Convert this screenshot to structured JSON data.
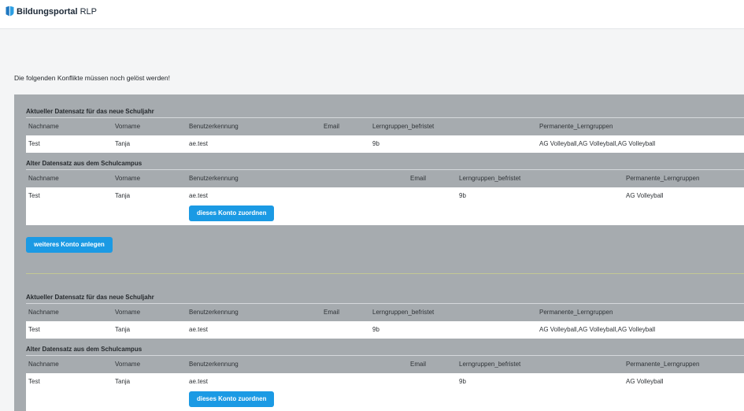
{
  "theme": {
    "accent": "#1b9ae4",
    "panel": "#a6abaf",
    "logo_dark": "#1f78c1",
    "logo_light": "#2d9fe3"
  },
  "header": {
    "logo_icon": "bildungsportal-logo-icon",
    "brand_name": "Bildungsportal",
    "brand_region": "RLP"
  },
  "intro": "Die folgenden Konflikte müssen noch gelöst werden!",
  "conflicts": [
    {
      "current": {
        "title": "Aktueller Datensatz für das neue Schuljahr",
        "columns": {
          "nachname": "Nachname",
          "vorname": "Vorname",
          "benutzerkennung": "Benutzerkennung",
          "email": "Email",
          "lerngruppen_befristet": "Lerngruppen_befristet",
          "permanente_lerngruppen": "Permanente_Lerngruppen"
        },
        "record": {
          "nachname": "Test",
          "vorname": "Tanja",
          "benutzerkennung": "ae.test",
          "lerngruppen_befristet": "9b",
          "permanente_lerngruppen": "AG Volleyball,AG Volleyball,AG Volleyball"
        }
      },
      "previous": {
        "title": "Alter Datensatz aus dem Schulcampus",
        "columns": {
          "nachname": "Nachname",
          "vorname": "Vorname",
          "benutzerkennung": "Benutzerkennung",
          "email": "Email",
          "lerngruppen_befristet": "Lerngruppen_befristet",
          "permanente_lerngruppen": "Permanente_Lerngruppen"
        },
        "record": {
          "nachname": "Test",
          "vorname": "Tanja",
          "benutzerkennung": "ae.test",
          "lerngruppen_befristet": "9b",
          "permanente_lerngruppen": "AG Volleyball"
        },
        "assign_button": "dieses Konto zuordnen"
      },
      "create_account_button": "weiteres Konto anlegen"
    },
    {
      "current": {
        "title": "Aktueller Datensatz für das neue Schuljahr",
        "columns": {
          "nachname": "Nachname",
          "vorname": "Vorname",
          "benutzerkennung": "Benutzerkennung",
          "email": "Email",
          "lerngruppen_befristet": "Lerngruppen_befristet",
          "permanente_lerngruppen": "Permanente_Lerngruppen"
        },
        "record": {
          "nachname": "Test",
          "vorname": "Tanja",
          "benutzerkennung": "ae.test",
          "lerngruppen_befristet": "9b",
          "permanente_lerngruppen": "AG Volleyball,AG Volleyball,AG Volleyball"
        }
      },
      "previous": {
        "title": "Alter Datensatz aus dem Schulcampus",
        "columns": {
          "nachname": "Nachname",
          "vorname": "Vorname",
          "benutzerkennung": "Benutzerkennung",
          "email": "Email",
          "lerngruppen_befristet": "Lerngruppen_befristet",
          "permanente_lerngruppen": "Permanente_Lerngruppen"
        },
        "record": {
          "nachname": "Test",
          "vorname": "Tanja",
          "benutzerkennung": "ae.test",
          "lerngruppen_befristet": "9b",
          "permanente_lerngruppen": "AG Volleyball"
        },
        "assign_button": "dieses Konto zuordnen"
      }
    }
  ]
}
